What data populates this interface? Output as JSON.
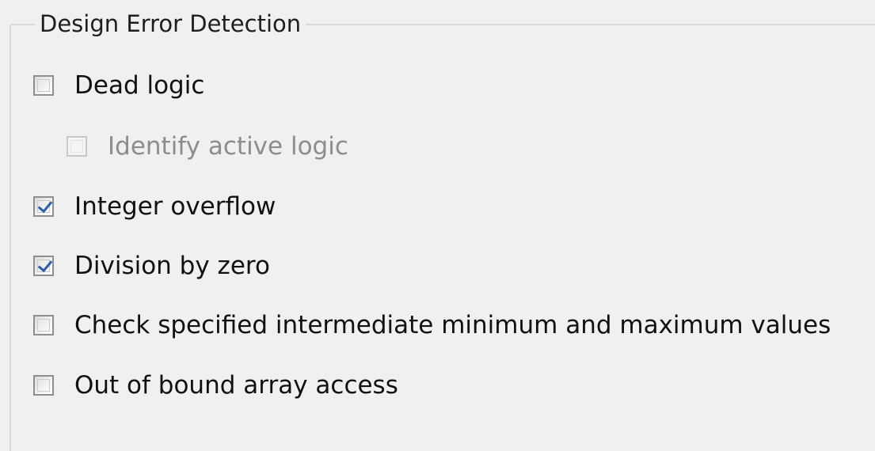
{
  "group": {
    "title": "Design Error Detection"
  },
  "options": [
    {
      "label": "Dead logic",
      "checked": false,
      "enabled": true
    },
    {
      "label": "Identify active logic",
      "checked": false,
      "enabled": false
    },
    {
      "label": "Integer overflow",
      "checked": true,
      "enabled": true
    },
    {
      "label": "Division by zero",
      "checked": true,
      "enabled": true
    },
    {
      "label": "Check specified intermediate minimum and maximum values",
      "checked": false,
      "enabled": true
    },
    {
      "label": "Out of bound array access",
      "checked": false,
      "enabled": true
    }
  ],
  "colors": {
    "background": "#f0f0f0",
    "border": "#d8d8d8",
    "text": "#111111",
    "disabled_text": "#8d8d8d",
    "checkmark": "#2f5fa8"
  }
}
